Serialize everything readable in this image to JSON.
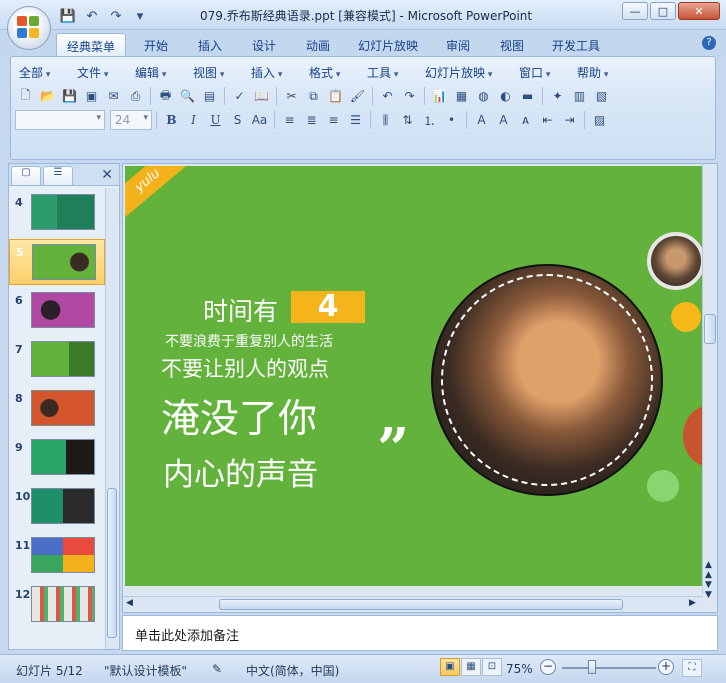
{
  "window": {
    "title": "079.乔布斯经典语录.ppt [兼容模式] - Microsoft PowerPoint"
  },
  "tabs": [
    "经典菜单",
    "开始",
    "插入",
    "设计",
    "动画",
    "幻灯片放映",
    "审阅",
    "视图",
    "开发工具"
  ],
  "active_tab": "经典菜单",
  "classic_menu": [
    "全部",
    "文件",
    "编辑",
    "视图",
    "插入",
    "格式",
    "工具",
    "幻灯片放映",
    "窗口",
    "帮助"
  ],
  "format_bar": {
    "font_size": "24",
    "bold": "B",
    "italic": "I",
    "underline": "U",
    "shadow": "S",
    "case": "Aa"
  },
  "slides_panel": {
    "slide_numbers": [
      "4",
      "5",
      "6",
      "7",
      "8",
      "9",
      "10",
      "11",
      "12"
    ],
    "selected": "5"
  },
  "slide": {
    "corner_text": "yulu",
    "heading_prefix": "时间有",
    "number": "4",
    "line2": "不要浪费于重复别人的生活",
    "line3": "不要让别人的观点",
    "line4": "淹没了你",
    "line5": "内心的声音",
    "quote_mark": "”"
  },
  "notes": {
    "placeholder": "单击此处添加备注"
  },
  "status": {
    "slide_info": "幻灯片 5/12",
    "template": "\"默认设计模板\"",
    "language": "中文(简体，中国)",
    "zoom": "75%"
  },
  "colors": {
    "slide_bg": "#62b23b",
    "accent_yellow": "#f6b41c",
    "accent_red": "#c8532f",
    "ribbon_bg": "#d9e7f7"
  }
}
